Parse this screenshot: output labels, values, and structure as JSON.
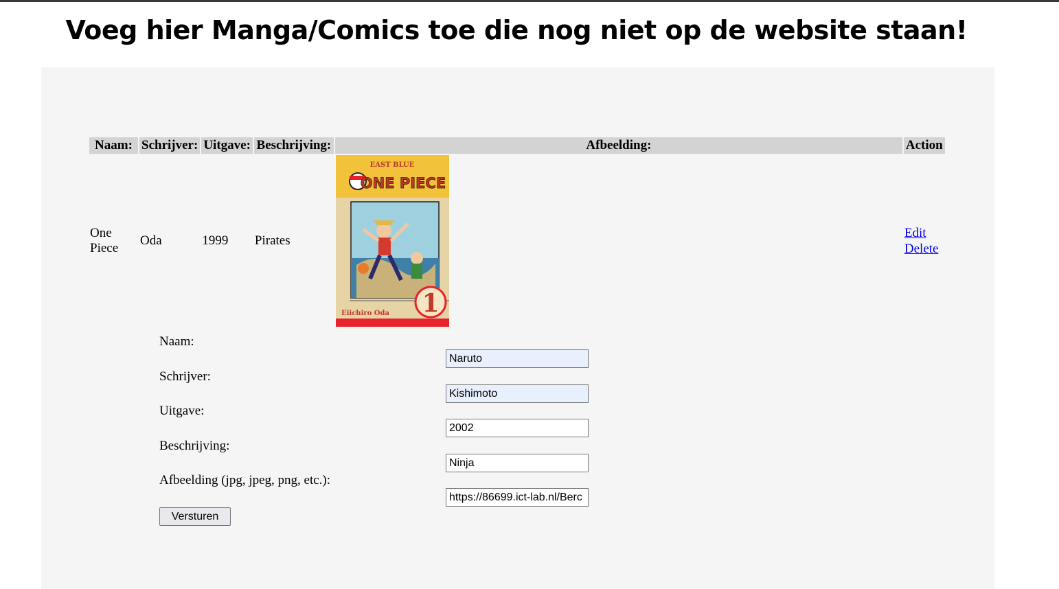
{
  "title": "Voeg hier Manga/Comics toe die nog niet op de website staan!",
  "table": {
    "headers": {
      "naam": "Naam:",
      "schrijver": "Schrijver:",
      "uitgave": "Uitgave:",
      "beschrijving": "Beschrijving:",
      "afbeelding": "Afbeelding:",
      "action": "Action"
    },
    "rows": [
      {
        "naam": "One Piece",
        "schrijver": "Oda",
        "uitgave": "1999",
        "beschrijving": "Pirates",
        "image": {
          "series": "ONE PIECE",
          "arc": "EAST BLUE",
          "author": "Eiichiro Oda",
          "volume": "1"
        },
        "edit": "Edit",
        "delete": "Delete"
      }
    ]
  },
  "form": {
    "labels": {
      "naam": "Naam:",
      "schrijver": "Schrijver:",
      "uitgave": "Uitgave:",
      "beschrijving": "Beschrijving:",
      "afbeelding": "Afbeelding (jpg, jpeg, png, etc.):"
    },
    "values": {
      "naam": "Naruto",
      "schrijver": "Kishimoto",
      "uitgave": "2002",
      "beschrijving": "Ninja",
      "afbeelding": "https://86699.ict-lab.nl/Berc"
    },
    "submit": "Versturen"
  },
  "colors": {
    "header_bg": "#d3d3d3",
    "panel_bg": "#f6f5f5",
    "link": "#0000ee",
    "autofill_bg": "#e8f0fe",
    "cover_yellow": "#f2c23a",
    "cover_red": "#e8222b"
  }
}
